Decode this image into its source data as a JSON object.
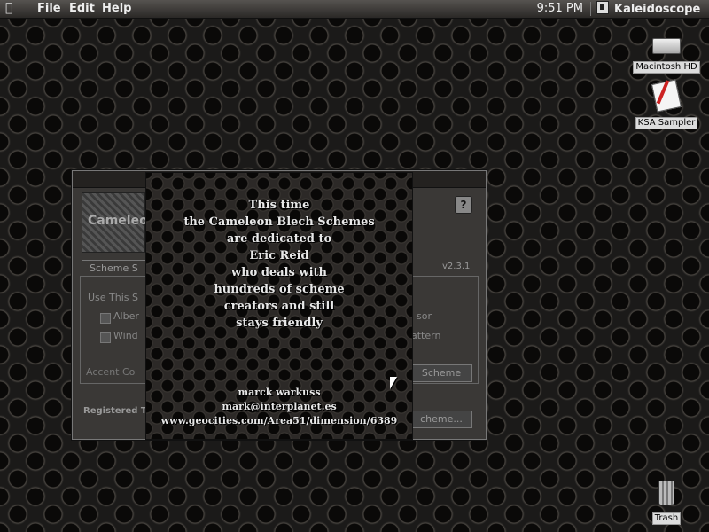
{
  "menubar": {
    "apple_icon": "apple-logo-icon",
    "items": [
      "File",
      "Edit",
      "Help"
    ],
    "clock": "9:51 PM",
    "app_name": "Kaleidoscope"
  },
  "desktop": {
    "icons": [
      {
        "label": "Macintosh HD",
        "icon": "hard-drive-icon"
      },
      {
        "label": "KSA Sampler",
        "icon": "document-icon"
      },
      {
        "label": "Trash",
        "icon": "trash-icon"
      }
    ]
  },
  "control_panel": {
    "title": "Cameleo",
    "version": "v2.3.1",
    "tab_label": "Scheme S",
    "use_label": "Use This S",
    "check_1": "Alber",
    "check_2": "Wind",
    "right_1": "sor",
    "right_2": "attern",
    "accent_label": "Accent Co",
    "scheme_button": "Scheme",
    "scheme_button_2": "cheme...",
    "registered": "Registered To",
    "help_label": "?"
  },
  "splash": {
    "dedication_lines": [
      "This time",
      "the Cameleon Blech Schemes",
      "are dedicated to",
      "Eric Reid",
      "who deals with",
      "hundreds of scheme",
      "creators and still",
      "stays friendly"
    ],
    "author": "marck warkuss",
    "email": "mark@interplanet.es",
    "url": "www.geocities.com/Area51/dimension/6389"
  },
  "colors": {
    "background": "#1b1a19",
    "menubar": "#3e3b38",
    "text": "#e8e8e8"
  }
}
